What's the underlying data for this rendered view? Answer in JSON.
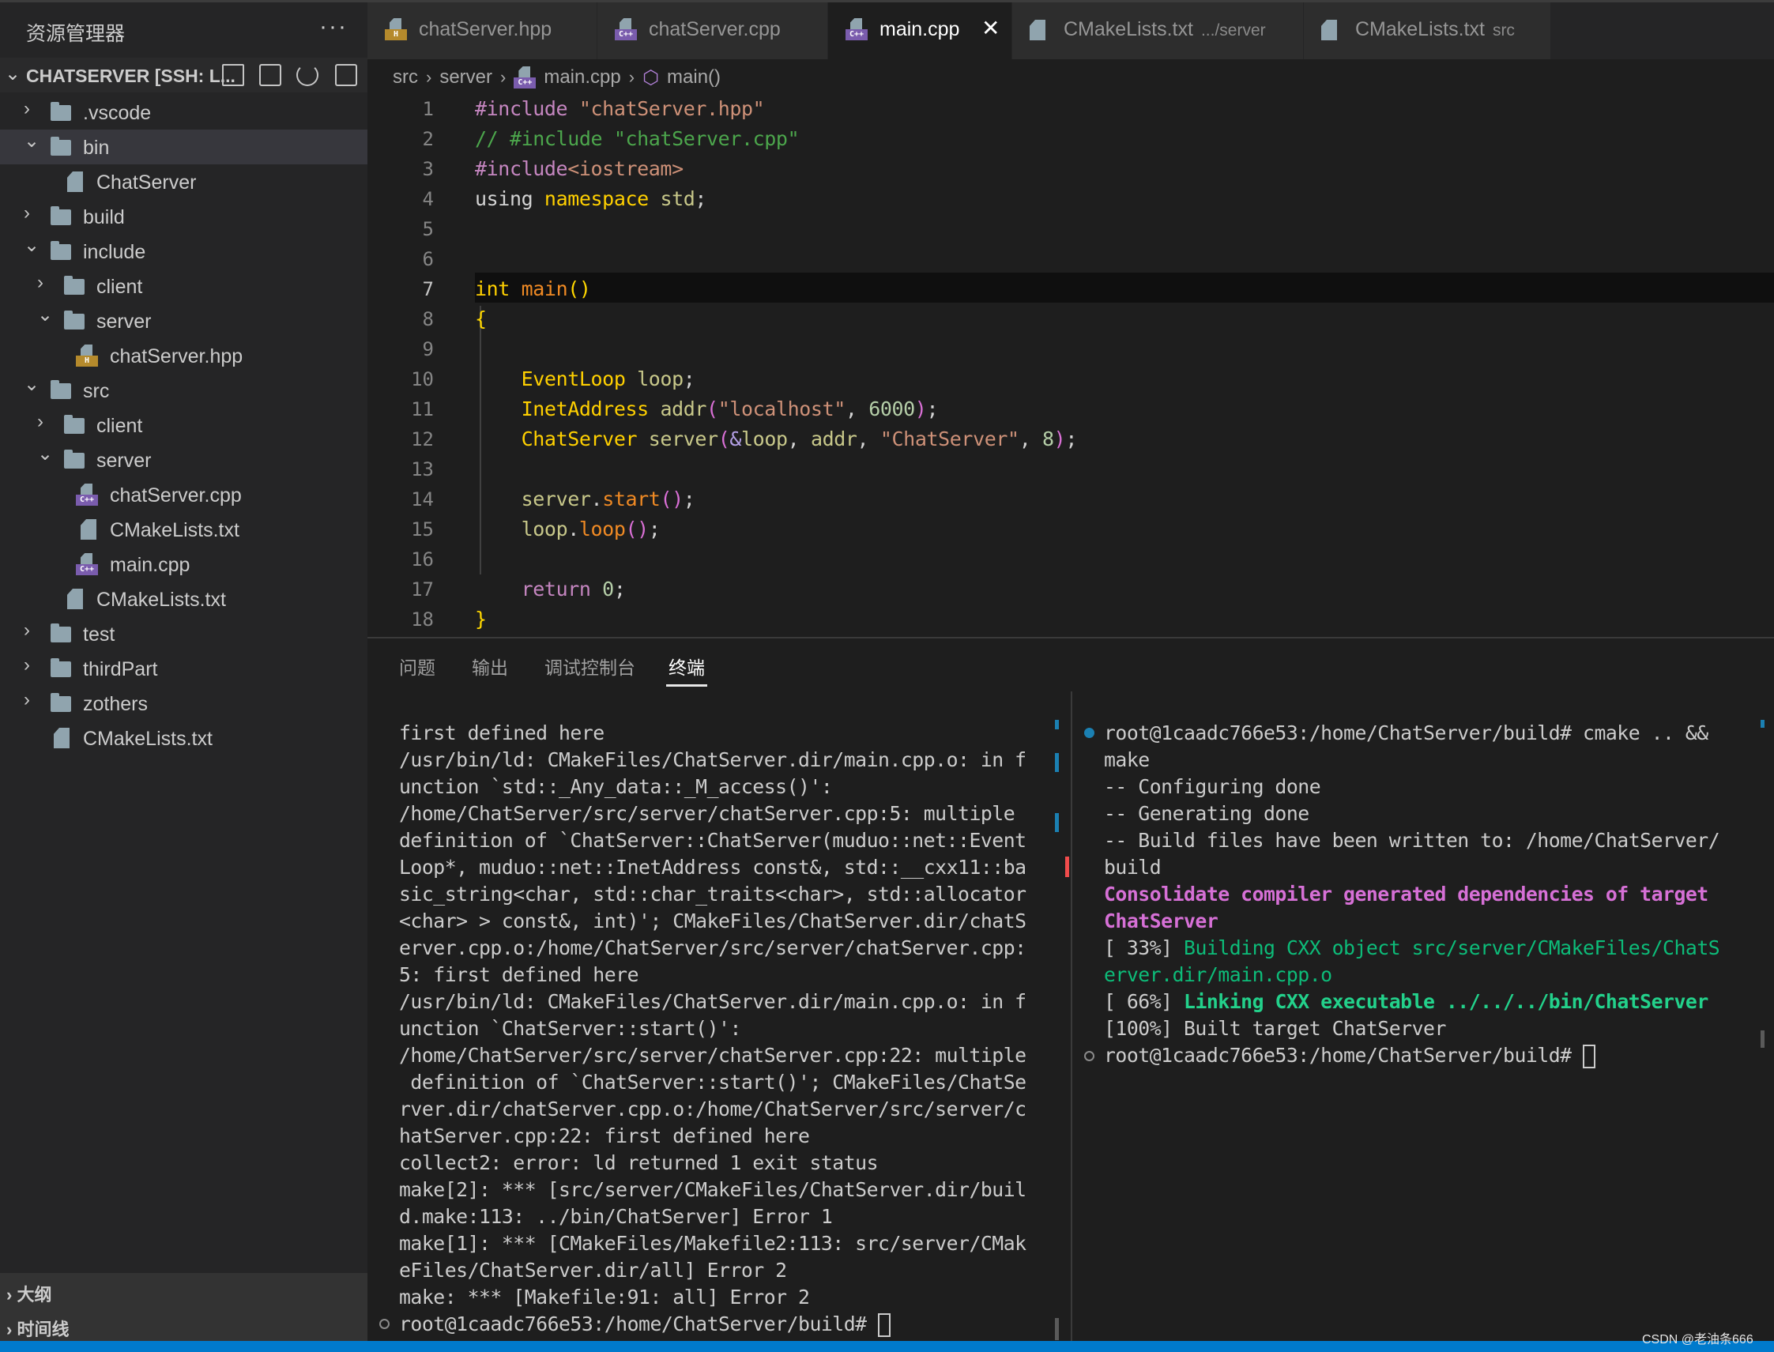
{
  "sidebar": {
    "title": "资源管理器",
    "more": "···",
    "root_label": "CHATSERVER [SSH: L...",
    "root_actions": [
      "new-file-icon",
      "new-folder-icon",
      "refresh-icon",
      "collapse-all-icon"
    ],
    "tree": [
      {
        "label": ".vscode",
        "type": "folder",
        "level": 0,
        "expanded": false
      },
      {
        "label": "bin",
        "type": "folder",
        "level": 0,
        "expanded": true,
        "selected": true
      },
      {
        "label": "ChatServer",
        "type": "file",
        "level": 1
      },
      {
        "label": "build",
        "type": "folder",
        "level": 0,
        "expanded": false
      },
      {
        "label": "include",
        "type": "folder",
        "level": 0,
        "expanded": true
      },
      {
        "label": "client",
        "type": "folder",
        "level": 1,
        "expanded": false
      },
      {
        "label": "server",
        "type": "folder",
        "level": 1,
        "expanded": true
      },
      {
        "label": "chatServer.hpp",
        "type": "hpp",
        "level": 2
      },
      {
        "label": "src",
        "type": "folder",
        "level": 0,
        "expanded": true
      },
      {
        "label": "client",
        "type": "folder",
        "level": 1,
        "expanded": false
      },
      {
        "label": "server",
        "type": "folder",
        "level": 1,
        "expanded": true
      },
      {
        "label": "chatServer.cpp",
        "type": "cpp",
        "level": 2
      },
      {
        "label": "CMakeLists.txt",
        "type": "file",
        "level": 2
      },
      {
        "label": "main.cpp",
        "type": "cpp",
        "level": 2
      },
      {
        "label": "CMakeLists.txt",
        "type": "file",
        "level": 1
      },
      {
        "label": "test",
        "type": "folder",
        "level": 0,
        "expanded": false
      },
      {
        "label": "thirdPart",
        "type": "folder",
        "level": 0,
        "expanded": false
      },
      {
        "label": "zothers",
        "type": "folder",
        "level": 0,
        "expanded": false
      },
      {
        "label": "CMakeLists.txt",
        "type": "file",
        "level": 0
      }
    ],
    "sections": [
      "大纲",
      "时间线"
    ]
  },
  "tabs": [
    {
      "name": "chatServer.hpp",
      "desc": "",
      "icon": "hpp",
      "active": false
    },
    {
      "name": "chatServer.cpp",
      "desc": "",
      "icon": "cpp",
      "active": false
    },
    {
      "name": "main.cpp",
      "desc": "",
      "icon": "cpp",
      "active": true,
      "close": "✕"
    },
    {
      "name": "CMakeLists.txt",
      "desc": ".../server",
      "icon": "file",
      "active": false
    },
    {
      "name": "CMakeLists.txt",
      "desc": "src",
      "icon": "file",
      "active": false
    }
  ],
  "breadcrumb": [
    "src",
    "server",
    "main.cpp",
    "main()"
  ],
  "editor": {
    "current_line": 7,
    "lines": [
      [
        [
          "#include ",
          "pp"
        ],
        [
          "\"chatServer.hpp\"",
          "str"
        ]
      ],
      [
        [
          "// #include \"chatServer.cpp\"",
          "cm"
        ]
      ],
      [
        [
          "#include",
          "pp"
        ],
        [
          "<iostream>",
          "str"
        ]
      ],
      [
        [
          "using ",
          "kw"
        ],
        [
          "namespace ",
          "type"
        ],
        [
          "std",
          "var"
        ],
        [
          ";",
          "pl"
        ]
      ],
      [],
      [],
      [
        [
          "int ",
          "type"
        ],
        [
          "main",
          "fn"
        ],
        [
          "()",
          "br"
        ]
      ],
      [
        [
          "{",
          "br"
        ]
      ],
      [],
      [
        [
          "    ",
          " "
        ],
        [
          "EventLoop ",
          "type"
        ],
        [
          "loop",
          "var"
        ],
        [
          ";",
          "pl"
        ]
      ],
      [
        [
          "    ",
          " "
        ],
        [
          "InetAddress ",
          "type"
        ],
        [
          "addr",
          "var"
        ],
        [
          "(",
          "pn"
        ],
        [
          "\"localhost\"",
          "str"
        ],
        [
          ", ",
          "pl"
        ],
        [
          "6000",
          "num"
        ],
        [
          ")",
          "pn"
        ],
        [
          ";",
          "pl"
        ]
      ],
      [
        [
          "    ",
          " "
        ],
        [
          "ChatServer ",
          "type"
        ],
        [
          "server",
          "var"
        ],
        [
          "(",
          "pn"
        ],
        [
          "&",
          "amp"
        ],
        [
          "loop",
          "var"
        ],
        [
          ", ",
          "pl"
        ],
        [
          "addr",
          "var"
        ],
        [
          ", ",
          "pl"
        ],
        [
          "\"ChatServer\"",
          "str"
        ],
        [
          ", ",
          "pl"
        ],
        [
          "8",
          "num"
        ],
        [
          ")",
          "pn"
        ],
        [
          ";",
          "pl"
        ]
      ],
      [],
      [
        [
          "    ",
          " "
        ],
        [
          "server",
          "var"
        ],
        [
          ".",
          "pl"
        ],
        [
          "start",
          "fn"
        ],
        [
          "()",
          "pn"
        ],
        [
          ";",
          "pl"
        ]
      ],
      [
        [
          "    ",
          " "
        ],
        [
          "loop",
          "var"
        ],
        [
          ".",
          "pl"
        ],
        [
          "loop",
          "fn"
        ],
        [
          "()",
          "pn"
        ],
        [
          ";",
          "pl"
        ]
      ],
      [],
      [
        [
          "    ",
          " "
        ],
        [
          "return ",
          "ret"
        ],
        [
          "0",
          "num"
        ],
        [
          ";",
          "pl"
        ]
      ],
      [
        [
          "}",
          "br"
        ]
      ]
    ]
  },
  "panel": {
    "tabs": [
      "问题",
      "输出",
      "调试控制台",
      "终端"
    ],
    "active_tab": "终端"
  },
  "terminal_left": [
    [
      [
        "first defined here",
        ""
      ]
    ],
    [
      [
        "/usr/bin/ld: CMakeFiles/ChatServer.dir/main.cpp.o: in f",
        ""
      ]
    ],
    [
      [
        "unction `std::_Any_data::_M_access()':",
        ""
      ]
    ],
    [
      [
        "/home/ChatServer/src/server/chatServer.cpp:5: multiple",
        ""
      ]
    ],
    [
      [
        "definition of `ChatServer::ChatServer(muduo::net::Event",
        ""
      ]
    ],
    [
      [
        "Loop*, muduo::net::InetAddress const&, std::__cxx11::ba",
        ""
      ]
    ],
    [
      [
        "sic_string<char, std::char_traits<char>, std::allocator",
        ""
      ]
    ],
    [
      [
        "<char> > const&, int)'; CMakeFiles/ChatServer.dir/chatS",
        ""
      ]
    ],
    [
      [
        "erver.cpp.o:/home/ChatServer/src/server/chatServer.cpp:",
        ""
      ]
    ],
    [
      [
        "5: first defined here",
        ""
      ]
    ],
    [
      [
        "/usr/bin/ld: CMakeFiles/ChatServer.dir/main.cpp.o: in f",
        ""
      ]
    ],
    [
      [
        "unction `ChatServer::start()':",
        ""
      ]
    ],
    [
      [
        "/home/ChatServer/src/server/chatServer.cpp:22: multiple",
        ""
      ]
    ],
    [
      [
        " definition of `ChatServer::start()'; CMakeFiles/ChatSe",
        ""
      ]
    ],
    [
      [
        "rver.dir/chatServer.cpp.o:/home/ChatServer/src/server/c",
        ""
      ]
    ],
    [
      [
        "hatServer.cpp:22: first defined here",
        ""
      ]
    ],
    [
      [
        "collect2: error: ld returned 1 exit status",
        ""
      ]
    ],
    [
      [
        "make[2]: *** [src/server/CMakeFiles/ChatServer.dir/buil",
        ""
      ]
    ],
    [
      [
        "d.make:113: ../bin/ChatServer] Error 1",
        ""
      ]
    ],
    [
      [
        "make[1]: *** [CMakeFiles/Makefile2:113: src/server/CMak",
        ""
      ]
    ],
    [
      [
        "eFiles/ChatServer.dir/all] Error 2",
        ""
      ]
    ],
    [
      [
        "make: *** [Makefile:91: all] Error 2",
        ""
      ]
    ],
    [
      [
        "root@1caadc766e53:/home/ChatServer/build# ",
        ""
      ]
    ]
  ],
  "terminal_right": [
    [
      [
        "root@1caadc766e53:/home/ChatServer/build# cmake .. &&",
        ""
      ]
    ],
    [
      [
        "make",
        ""
      ]
    ],
    [
      [
        "-- Configuring done",
        ""
      ]
    ],
    [
      [
        "-- Generating done",
        ""
      ]
    ],
    [
      [
        "-- Build files have been written to: /home/ChatServer/",
        ""
      ]
    ],
    [
      [
        "build",
        ""
      ]
    ],
    [
      [
        "Consolidate compiler generated dependencies of target",
        "tm"
      ]
    ],
    [
      [
        "ChatServer",
        "tm"
      ]
    ],
    [
      [
        "[ 33%] ",
        ""
      ],
      [
        "Building CXX object src/server/CMakeFiles/ChatS",
        "tg"
      ]
    ],
    [
      [
        "erver.dir/main.cpp.o",
        "tg"
      ]
    ],
    [
      [
        "[ 66%] ",
        ""
      ],
      [
        "Linking CXX executable ../../../bin/ChatServer",
        "tgb"
      ]
    ],
    [
      [
        "[100%] Built target ChatServer",
        ""
      ]
    ],
    [
      [
        "root@1caadc766e53:/home/ChatServer/build# ",
        ""
      ]
    ]
  ],
  "colors": {
    "accent": "#007acc",
    "error_marker": "#f14c4c",
    "info_marker": "#1b80b2"
  },
  "watermark": "CSDN @老油条666"
}
